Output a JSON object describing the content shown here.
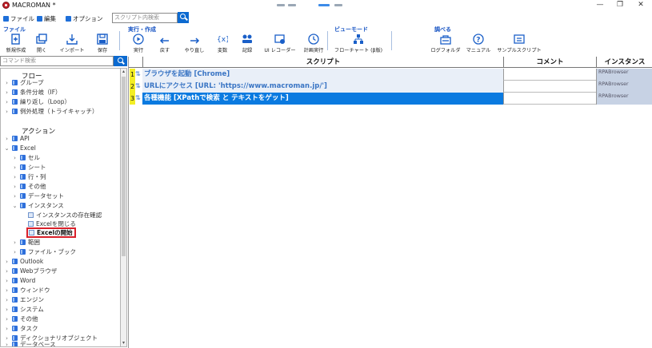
{
  "window": {
    "title": "MACROMAN *",
    "controls": {
      "minimize": "—",
      "maximize": "❐",
      "close": "✕"
    }
  },
  "menu": {
    "file": "ファイル",
    "edit": "編集",
    "options": "オプション",
    "search_placeholder": "スクリプト内検索"
  },
  "ribbon": {
    "groups": {
      "file": "ファイル",
      "run_create": "実行・作成",
      "view_mode": "ビューモード",
      "lookup": "調べる"
    },
    "buttons": {
      "new": "新規作成",
      "open": "開く",
      "import": "インポート",
      "save": "保存",
      "run": "実行",
      "undo": "戻す",
      "redo": "やり直し",
      "variables": "変数",
      "record": "記録",
      "ui_recorder": "UI レコーダー",
      "scheduled_run": "計画実行",
      "flowchart": "フローチャート (β版)",
      "log_folder": "ログフォルダ",
      "manual": "マニュアル",
      "sample_scripts": "サンプルスクリプト"
    }
  },
  "command_search": {
    "placeholder": "コマンド検索"
  },
  "tree": {
    "flow_header": "フロー",
    "flow_items": [
      "グループ",
      "条件分岐（IF）",
      "繰り返し（Loop）",
      "例外処理（トライキャッチ）"
    ],
    "action_header": "アクション",
    "api": "API",
    "excel": "Excel",
    "excel_children": [
      "セル",
      "シート",
      "行・列",
      "その他",
      "データセット"
    ],
    "instance": "インスタンス",
    "instance_children": [
      "インスタンスの存在確認",
      "Excelを閉じる"
    ],
    "selected": "Excelの開始",
    "excel_tail": [
      "範囲",
      "ファイル・ブック"
    ],
    "after_excel": [
      "Outlook",
      "Webブラウザ",
      "Word",
      "ウィンドウ",
      "エンジン",
      "システム",
      "その他",
      "タスク",
      "ディクショナリオブジェクト",
      "データベース"
    ]
  },
  "grid": {
    "headers": {
      "script": "スクリプト",
      "comment": "コメント",
      "instance": "インスタンス"
    },
    "rows": [
      {
        "num": "1",
        "text": "ブラウザを起動 [Chrome]",
        "instance": "RPABrowser"
      },
      {
        "num": "2",
        "text": "URLにアクセス [URL: 'https://www.macroman.jp/']",
        "instance": "RPABrowser"
      },
      {
        "num": "3",
        "text": "各種機能 [XPathで検索 と テキストをゲット]",
        "instance": "RPABrowser"
      }
    ]
  },
  "colors": {
    "accent": "#0a7ae0",
    "group_label": "#1a56c4",
    "row_number": "#f3ee25",
    "instance_cell": "#c7d2e4",
    "selection_border": "#d8202a"
  }
}
